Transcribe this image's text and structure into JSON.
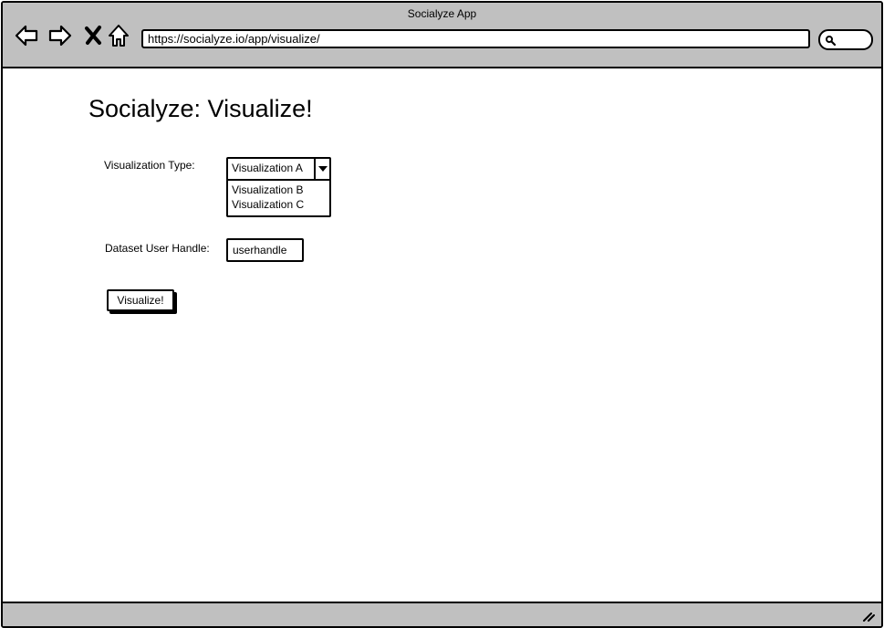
{
  "window": {
    "title": "Socialyze App",
    "url": "https://socialyze.io/app/visualize/"
  },
  "nav": {
    "back_icon": "back-arrow-icon",
    "forward_icon": "forward-arrow-icon",
    "stop_icon": "close-icon",
    "home_icon": "home-icon",
    "search_icon": "search-icon"
  },
  "page": {
    "title": "Socialyze: Visualize!",
    "visualization_type_label": "Visualization Type:",
    "visualization_type_selected": "Visualization A",
    "visualization_type_options": [
      "Visualization B",
      "Visualization C"
    ],
    "dataset_handle_label": "Dataset User Handle:",
    "dataset_handle_value": "userhandle",
    "submit_label": "Visualize!"
  },
  "colors": {
    "chrome": "#c0c0c0",
    "background": "#ffffff",
    "stroke": "#000000"
  }
}
